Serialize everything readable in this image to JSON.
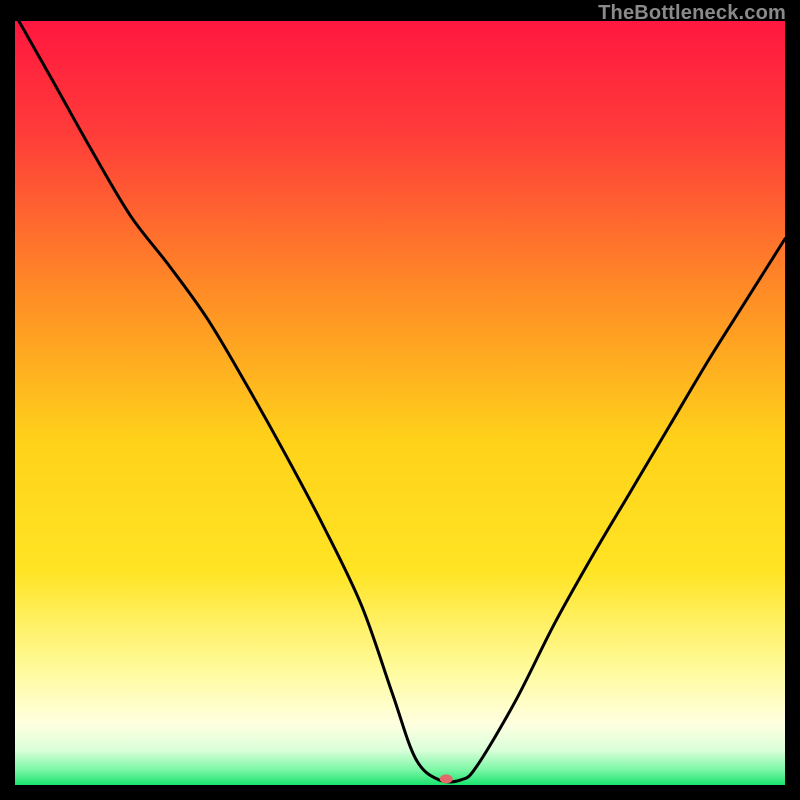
{
  "watermark": "TheBottleneck.com",
  "chart_data": {
    "type": "line",
    "title": "",
    "xlabel": "",
    "ylabel": "",
    "xlim": [
      0,
      100
    ],
    "ylim": [
      0,
      100
    ],
    "gradient_stops": [
      {
        "offset": 0.0,
        "color": "#ff173f"
      },
      {
        "offset": 0.15,
        "color": "#ff3d3a"
      },
      {
        "offset": 0.35,
        "color": "#ff8a26"
      },
      {
        "offset": 0.55,
        "color": "#ffd21a"
      },
      {
        "offset": 0.72,
        "color": "#ffe424"
      },
      {
        "offset": 0.85,
        "color": "#fffb9d"
      },
      {
        "offset": 0.92,
        "color": "#ffffe0"
      },
      {
        "offset": 0.955,
        "color": "#d9ffd9"
      },
      {
        "offset": 0.98,
        "color": "#7cf7a6"
      },
      {
        "offset": 1.0,
        "color": "#19e36e"
      }
    ],
    "series": [
      {
        "name": "bottleneck-curve",
        "x": [
          0.5,
          5,
          10,
          15,
          20,
          25,
          30,
          35,
          40,
          45,
          49,
          52,
          55,
          58,
          60,
          65,
          70,
          75,
          80,
          85,
          90,
          95,
          100
        ],
        "y": [
          100,
          92,
          83,
          74.5,
          68,
          61,
          52.5,
          43.5,
          34,
          23.5,
          12,
          3.5,
          0.7,
          0.7,
          2.5,
          11,
          21,
          30,
          38.5,
          47,
          55.5,
          63.5,
          71.5
        ]
      }
    ],
    "marker": {
      "x": 56,
      "y": 0.8,
      "color": "#e26a6a",
      "rx": 6.5,
      "ry": 4.5
    }
  }
}
